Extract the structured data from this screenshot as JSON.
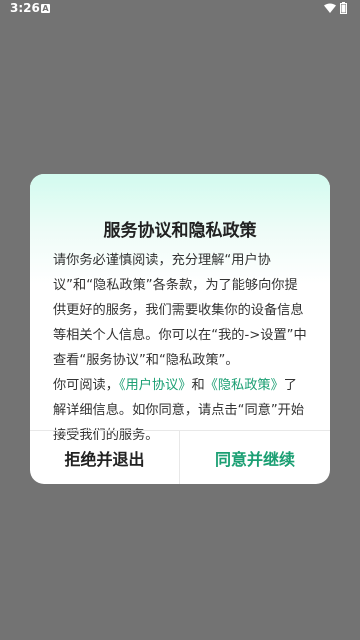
{
  "status_bar": {
    "time": "3:26",
    "notification_glyph": "A",
    "icons": [
      "notification-icon",
      "wifi-icon",
      "battery-icon"
    ]
  },
  "dialog": {
    "title": "服务协议和隐私政策",
    "paragraph1": "请你务必谨慎阅读，充分理解“用户协议”和“隐私政策”各条款，为了能够向你提供更好的服务，我们需要收集你的设备信息等相关个人信息。你可以在“我的->设置”中查看“服务协议”和“隐私政策”。",
    "paragraph2_prefix": "你可阅读，",
    "user_agreement_link": "《用户协议》",
    "and_text": "和",
    "privacy_policy_link": "《隐私政策》",
    "paragraph2_suffix": "了解详细信息。如你同意，请点击“同意”开始接受我们的服务。",
    "reject_button": "拒绝并退出",
    "agree_button": "同意并继续"
  },
  "colors": {
    "overlay": "#737373",
    "accent_green": "#1b9f73",
    "header_gradient_top": "#d2fbef"
  }
}
